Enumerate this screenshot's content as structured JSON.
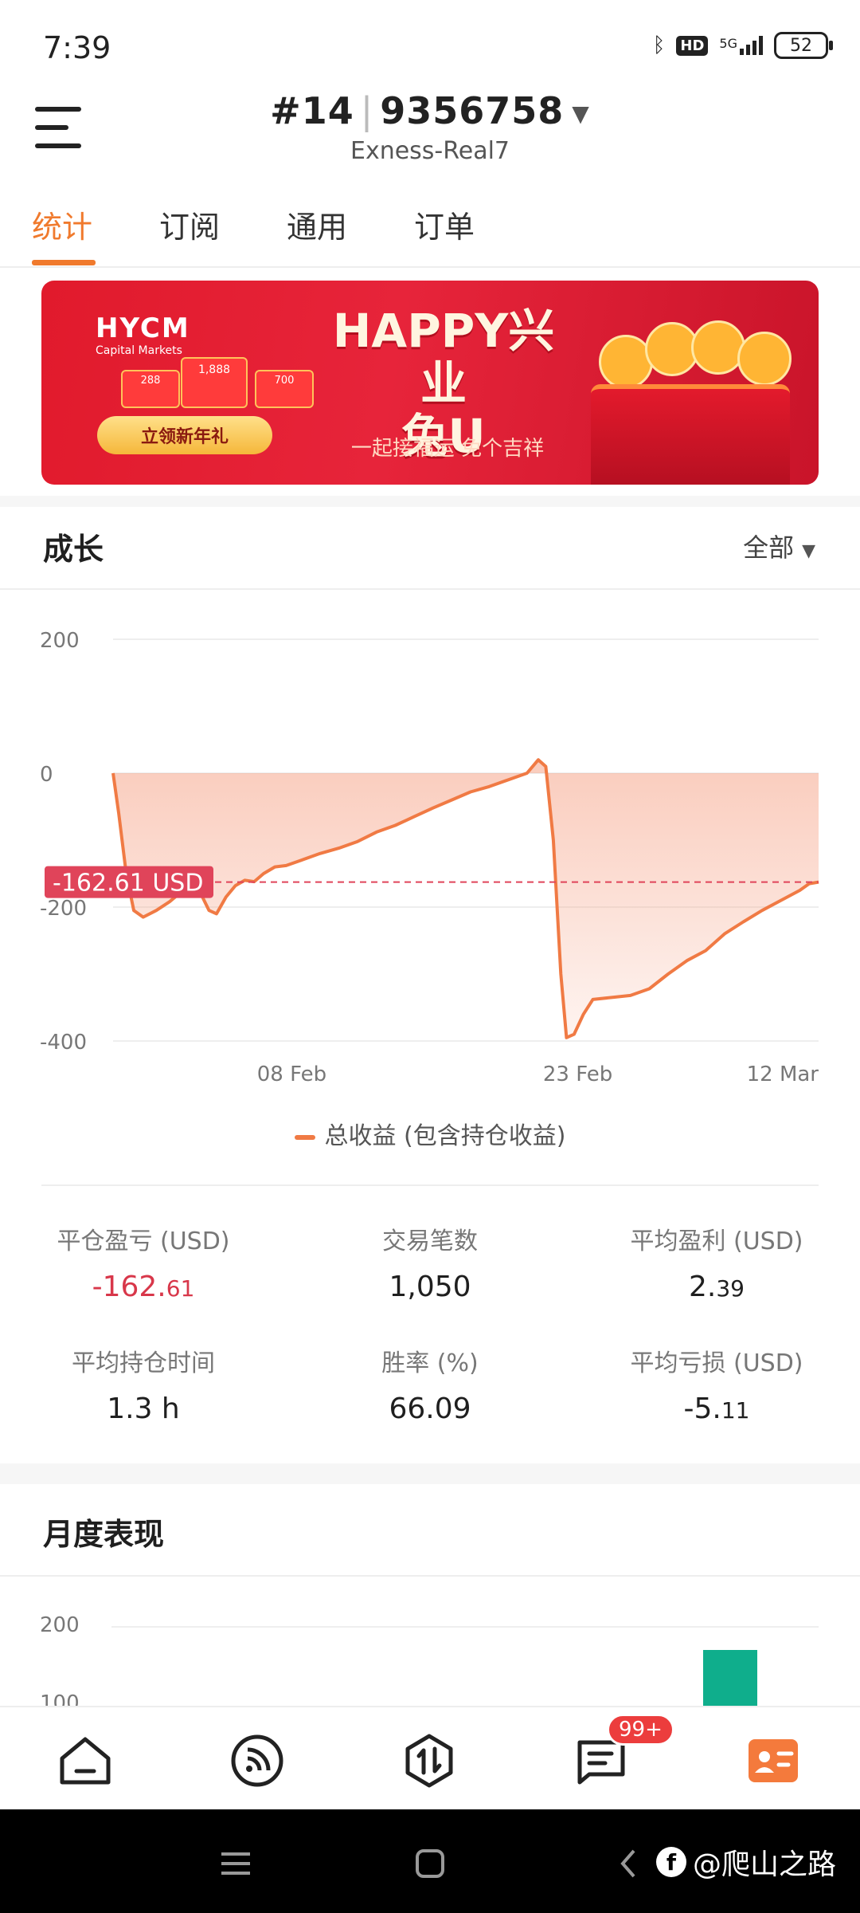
{
  "status_bar": {
    "time": "7:39",
    "network": "5G",
    "hd": "HD",
    "battery": "52"
  },
  "header": {
    "account_prefix": "#14",
    "account_suffix": "9356758",
    "server": "Exness-Real7"
  },
  "tabs": [
    {
      "label": "统计",
      "active": true
    },
    {
      "label": "订阅",
      "active": false
    },
    {
      "label": "通用",
      "active": false
    },
    {
      "label": "订单",
      "active": false
    }
  ],
  "banner": {
    "logo": "HYCM",
    "logo_sub": "Capital Markets",
    "title_line1": "HAPPY兴业",
    "title_line2": "兔U",
    "subtitle": "一起接福运 免个吉祥",
    "button": "立领新年礼",
    "envelope_amounts": [
      "288",
      "1,888",
      "700"
    ]
  },
  "growth": {
    "title": "成长",
    "filter": "全部",
    "legend": "总收益 (包含持仓收益)",
    "current_label": "-162.61 USD"
  },
  "chart_data": {
    "type": "area",
    "title": "",
    "series": [
      {
        "name": "总收益 (包含持仓收益)",
        "points": [
          [
            0,
            0
          ],
          [
            0.3,
            -60
          ],
          [
            0.7,
            -150
          ],
          [
            1.1,
            -205
          ],
          [
            1.6,
            -215
          ],
          [
            2.3,
            -205
          ],
          [
            3,
            -192
          ],
          [
            3.6,
            -178
          ],
          [
            4.2,
            -170
          ],
          [
            4.7,
            -182
          ],
          [
            5.1,
            -205
          ],
          [
            5.5,
            -210
          ],
          [
            6,
            -185
          ],
          [
            6.5,
            -168
          ],
          [
            7,
            -160
          ],
          [
            7.5,
            -162
          ],
          [
            8,
            -150
          ],
          [
            8.6,
            -140
          ],
          [
            9.2,
            -138
          ],
          [
            10,
            -130
          ],
          [
            11,
            -120
          ],
          [
            12,
            -112
          ],
          [
            13,
            -102
          ],
          [
            14,
            -88
          ],
          [
            15,
            -78
          ],
          [
            16,
            -65
          ],
          [
            17,
            -52
          ],
          [
            18,
            -40
          ],
          [
            19,
            -28
          ],
          [
            20,
            -20
          ],
          [
            21,
            -10
          ],
          [
            22,
            0
          ],
          [
            22.6,
            20
          ],
          [
            23,
            10
          ],
          [
            23.4,
            -100
          ],
          [
            23.8,
            -300
          ],
          [
            24.1,
            -395
          ],
          [
            24.5,
            -390
          ],
          [
            25,
            -360
          ],
          [
            25.5,
            -338
          ],
          [
            26.5,
            -335
          ],
          [
            27.5,
            -332
          ],
          [
            28.5,
            -322
          ],
          [
            29.5,
            -300
          ],
          [
            30.5,
            -280
          ],
          [
            31.5,
            -265
          ],
          [
            32.5,
            -240
          ],
          [
            33.5,
            -222
          ],
          [
            34.5,
            -205
          ],
          [
            35.5,
            -190
          ],
          [
            36.5,
            -175
          ],
          [
            37,
            -165
          ],
          [
            37.5,
            -162.61
          ]
        ]
      }
    ],
    "x_ticks": [
      {
        "value": 9.5,
        "label": "08 Feb"
      },
      {
        "value": 24.7,
        "label": "23 Feb"
      },
      {
        "value": 37.5,
        "label": "12 Mar"
      }
    ],
    "y_ticks": [
      200,
      0,
      -200,
      -400
    ],
    "ylim": [
      -400,
      200
    ],
    "xlim": [
      0,
      37.5
    ],
    "current_value": -162.61,
    "grid": true,
    "legend_position": "bottom"
  },
  "stats": [
    {
      "label": "平仓盈亏 (USD)",
      "int": "-162.",
      "dec": "61",
      "negative": true
    },
    {
      "label": "交易笔数",
      "int": "1,050",
      "dec": "",
      "negative": false
    },
    {
      "label": "平均盈利 (USD)",
      "int": "2.",
      "dec": "39",
      "negative": false
    },
    {
      "label": "平均持仓时间",
      "int": "1.3 h",
      "dec": "",
      "negative": false
    },
    {
      "label": "胜率 (%)",
      "int": "66.09",
      "dec": "",
      "negative": false
    },
    {
      "label": "平均亏损 (USD)",
      "int": "-5.",
      "dec": "11",
      "negative": false
    }
  ],
  "monthly": {
    "title": "月度表现",
    "y_ticks": [
      "200",
      "100"
    ],
    "bar_color": "#0fae8c"
  },
  "bottom_nav": {
    "badge": "99+"
  },
  "watermark": "@爬山之路",
  "colors": {
    "accent": "#f07a2d",
    "line": "#f07a44",
    "negative": "#d8374a",
    "label_bg": "#e0445a"
  }
}
